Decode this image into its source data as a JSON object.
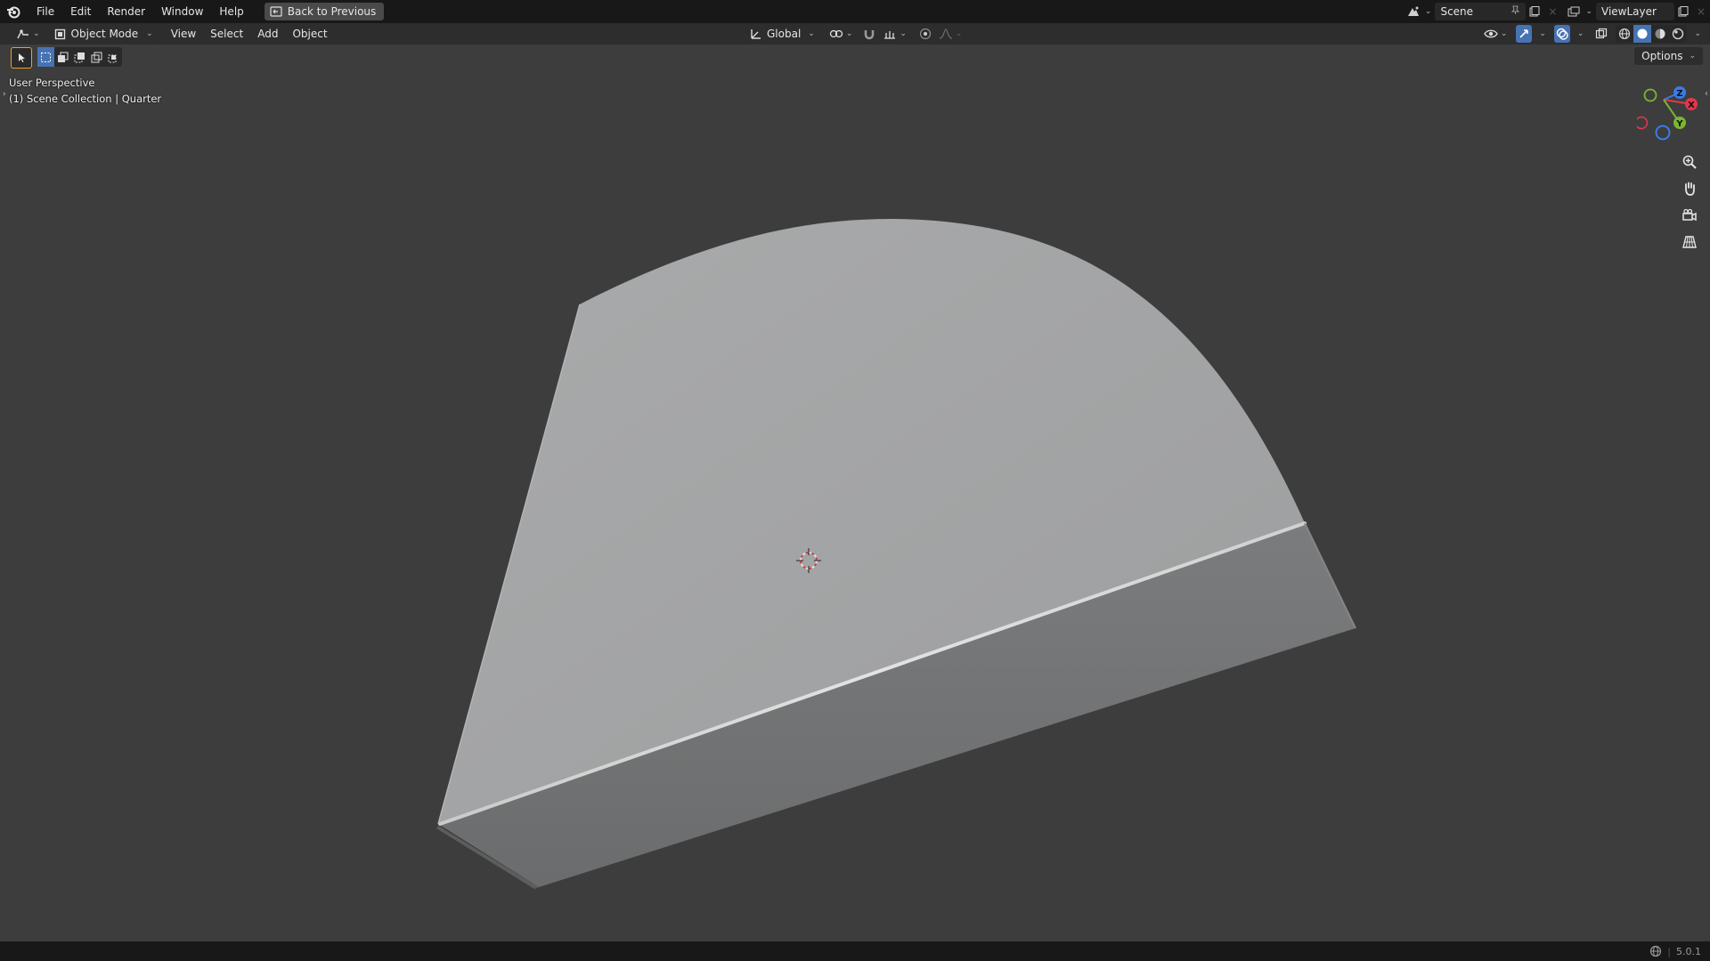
{
  "menubar": {
    "items": [
      "File",
      "Edit",
      "Render",
      "Window",
      "Help"
    ],
    "back_button": "Back to Previous"
  },
  "topbar_right": {
    "scene_name": "Scene",
    "view_layer_name": "ViewLayer"
  },
  "header": {
    "mode": "Object Mode",
    "menus": [
      "View",
      "Select",
      "Add",
      "Object"
    ],
    "transform_orientation": "Global",
    "options_label": "Options"
  },
  "viewport": {
    "view_name": "User Perspective",
    "collection_info": "(1) Scene Collection | Quarter"
  },
  "gizmo": {
    "x_label": "X",
    "y_label": "Y",
    "z_label": "Z",
    "x_color": "#e0384e",
    "y_color": "#7bb631",
    "z_color": "#3b7be8"
  },
  "status": {
    "version": "5.0.1"
  },
  "colors": {
    "accent": "#4772b3",
    "background": "#3d3d3d",
    "topbar": "#181818"
  }
}
